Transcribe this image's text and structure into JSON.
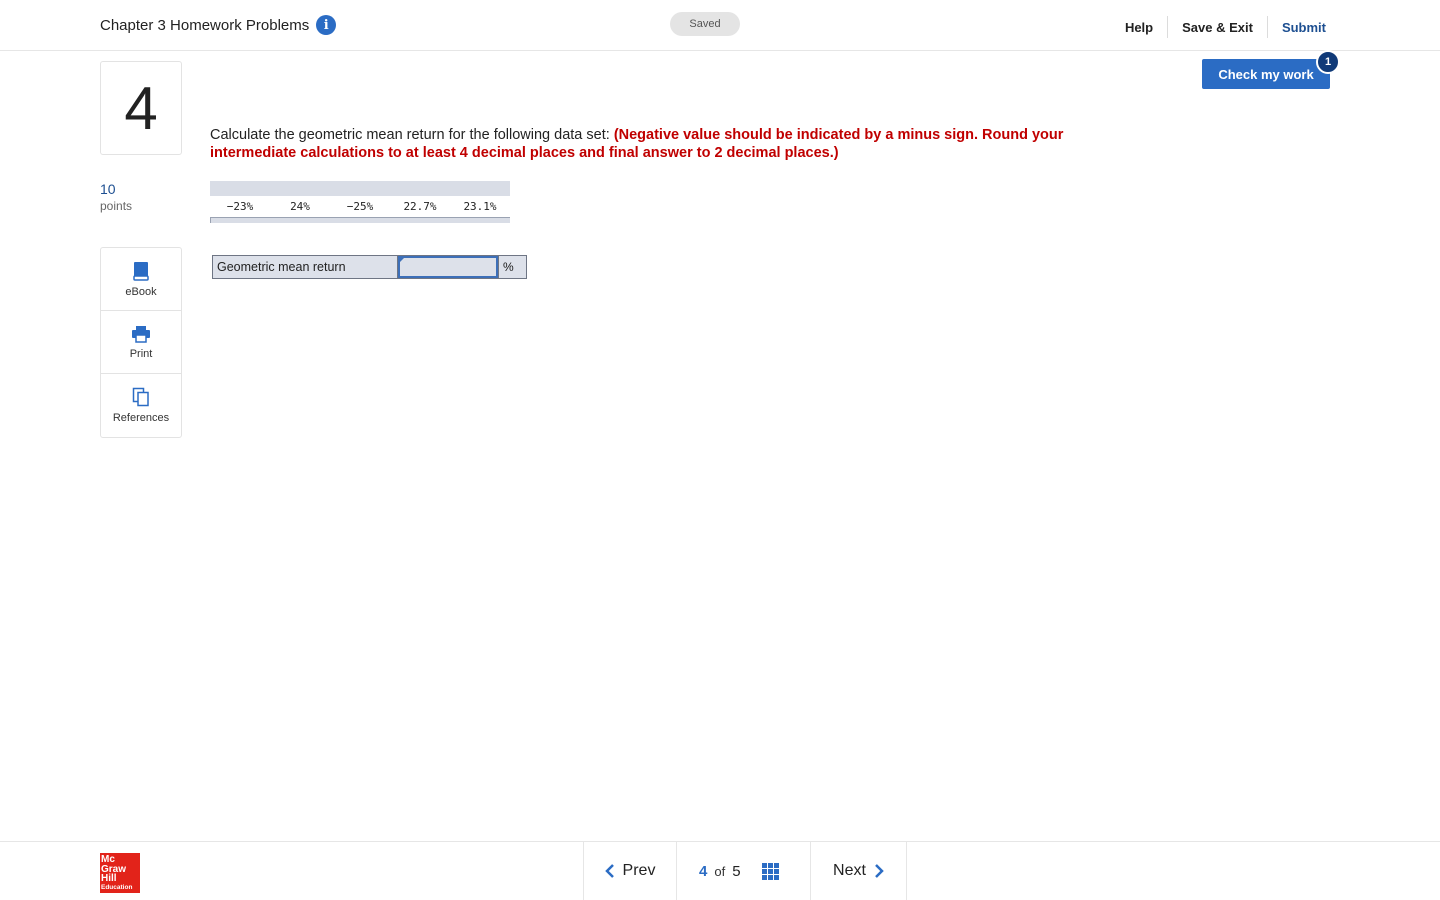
{
  "header": {
    "title": "Chapter 3 Homework Problems",
    "info_glyph": "i",
    "saved_label": "Saved",
    "links": {
      "help": "Help",
      "save_exit": "Save & Exit",
      "submit": "Submit"
    }
  },
  "question": {
    "number": "4",
    "points_value": "10",
    "points_label": "points",
    "text_plain": "Calculate the geometric mean return for the following data set: ",
    "text_instruction": "(Negative value should be indicated by a minus sign. Round your intermediate calculations to at least 4 decimal places and final answer to 2 decimal places.)",
    "data_values": [
      "−23%",
      "24%",
      "−25%",
      "22.7%",
      "23.1%"
    ],
    "answer_label": "Geometric mean return",
    "answer_value": "",
    "answer_unit": "%"
  },
  "tools": {
    "ebook": "eBook",
    "print": "Print",
    "references": "References"
  },
  "check": {
    "label": "Check my work",
    "badge": "1"
  },
  "footer": {
    "logo_lines": [
      "Mc",
      "Graw",
      "Hill",
      "Education"
    ],
    "prev": "Prev",
    "current": "4",
    "of": "of",
    "total": "5",
    "next": "Next"
  },
  "colors": {
    "accent": "#2b6cc4",
    "instruction_red": "#c00000",
    "logo_red": "#e2231a"
  }
}
